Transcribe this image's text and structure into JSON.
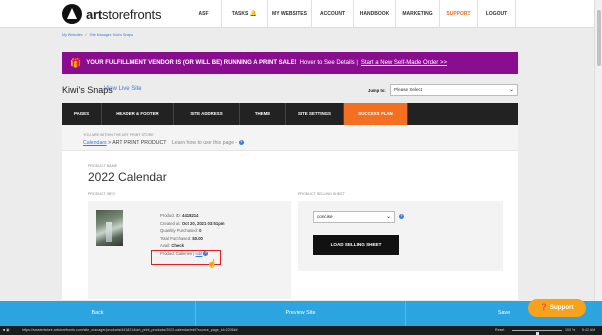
{
  "brand": {
    "name_prefix": "art",
    "name_suffix": "storefronts"
  },
  "nav": [
    "ASF",
    "TASKS",
    "MY WEBSITES",
    "ACCOUNT",
    "HANDBOOK",
    "MARKETING",
    "SUPPORT",
    "LOGOUT"
  ],
  "breadcrumb": {
    "first": "My Websites",
    "sep": "/",
    "second": "Site Manager: Kiwi's Snaps"
  },
  "banner": {
    "headline": "YOUR FULFILLMENT VENDOR IS (OR WILL BE) RUNNING A PRINT SALE!",
    "sub": "Hover to See Details |",
    "link": "Start a New Self-Made Order >>"
  },
  "store": {
    "title": "Kiwi's Snaps",
    "view_live": "View Live Site"
  },
  "jump": {
    "label": "Jump to:",
    "value": "Please Select"
  },
  "tabs": [
    "PAGES",
    "HEADER & FOOTER",
    "SITE ADDRESS",
    "THEME",
    "SITE SETTINGS",
    "SUCCESS PLAN"
  ],
  "location": {
    "label": "YOU ARE WITHIN THE ART PRINT STORE",
    "link": "Calendars",
    "rest": " > ART PRINT PRODUCT",
    "help": "Learn how to use this page -"
  },
  "product": {
    "name_label": "PRODUCT NAME",
    "name": "2022 Calendar",
    "info_label": "PRODUCT INFO",
    "id_label": "Product ID:",
    "id": "4418214",
    "created_label": "Created at:",
    "created": "Oct 20, 2021 03:51pm",
    "qty_label": "Quantity Purchased:",
    "qty": "0",
    "total_label": "Total Purchased:",
    "total": "$0.00",
    "avail_label": "Avail:",
    "avail": "Check",
    "galleries_label": "Product Galleries |",
    "galleries_link": "edit"
  },
  "selling_sheet": {
    "label": "PRODUCT SELLING SHEET",
    "value": "concise",
    "button": "LOAD SELLING SHEET"
  },
  "actions": {
    "back": "Back",
    "preview": "Preview Site",
    "save": "Save"
  },
  "support": "Support",
  "statusbar": {
    "url": "https://rosstertstore.artstorefronts.com/site_manager/products/4418214/art_print_products/2022-calendar/edit?source_page_id=2205##",
    "zoom_reset": "Reset",
    "zoom": "100 %",
    "time": "5:42 AM"
  },
  "colors": {
    "banner": "#8b0d8f",
    "accent": "#f36f21",
    "action_bar": "#2ba4e0",
    "support": "#f7a21d"
  }
}
